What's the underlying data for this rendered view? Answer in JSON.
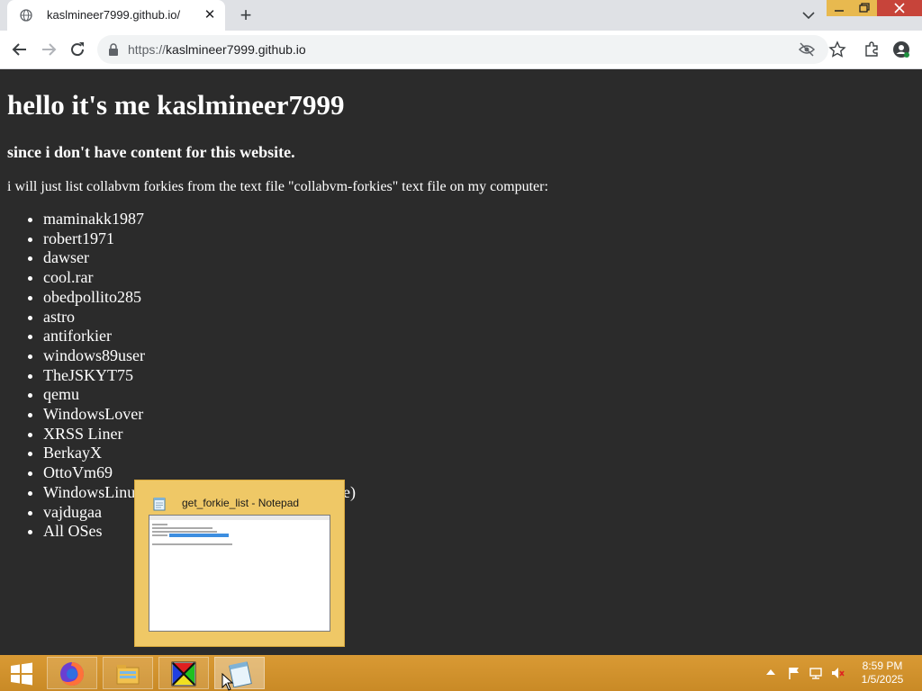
{
  "browser": {
    "tab_title": "kaslmineer7999.github.io/",
    "tab_close_glyph": "✕",
    "new_tab_glyph": "+",
    "url_scheme": "https://",
    "url_host": "kaslmineer7999.github.io",
    "icons": [
      "globe-icon",
      "back-icon",
      "forward-icon",
      "reload-icon",
      "lock-icon",
      "eye-off-icon",
      "star-icon",
      "puzzle-icon",
      "profile-icon",
      "chevron-down-icon",
      "minimize-icon",
      "restore-icon",
      "close-icon"
    ]
  },
  "page": {
    "heading": "hello it's me kaslmineer7999",
    "subheading": "since i don't have content for this website.",
    "intro": "i will just list collabvm forkies from the text file \"collabvm-forkies\" text file on my computer:",
    "forkies": [
      "maminakk1987",
      "robert1971",
      "dawser",
      "cool.rar",
      "obedpollito285",
      "astro",
      "antiforkier",
      "windows89user",
      "TheJSKYT75",
      "qemu",
      "WindowsLover",
      "XRSS Liner",
      "BerkayX",
      "OttoVm69",
      "WindowsLinu",
      "vajdugaa",
      "All OSes"
    ],
    "obscured_fragment": "e)"
  },
  "thumbnail": {
    "title": "get_forkie_list - Notepad",
    "icon": "notepad-icon"
  },
  "taskbar": {
    "apps": [
      "start-icon",
      "firefox-icon",
      "file-explorer-icon",
      "paint-icon",
      "notepad-icon"
    ],
    "clock_time": "8:59 PM",
    "clock_date": "1/5/2025"
  },
  "colors": {
    "page_bg": "#2b2b2b",
    "taskbar": "#d99a34",
    "close_button": "#c7443a",
    "thumbnail_bg": "#efc866"
  }
}
